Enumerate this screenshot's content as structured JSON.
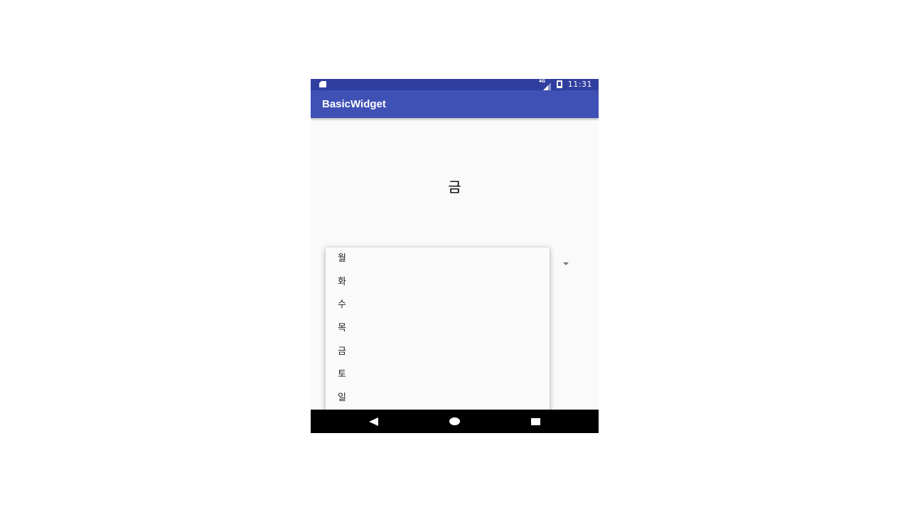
{
  "status_bar": {
    "network_label": "4G",
    "time": "11:31"
  },
  "app_bar": {
    "title": "BasicWidget"
  },
  "main": {
    "selected_day": "금"
  },
  "spinner": {
    "options": [
      "월",
      "화",
      "수",
      "목",
      "금",
      "토",
      "일"
    ]
  },
  "icons": {
    "status": [
      "sd-card-icon",
      "network-signal-icon",
      "battery-icon"
    ],
    "nav": [
      "back-icon",
      "home-icon",
      "recents-icon"
    ],
    "spinner": "dropdown-arrow-icon"
  },
  "colors": {
    "status_bar": "#303f9f",
    "app_bar": "#3f51b5",
    "background": "#fafafa",
    "nav_bar": "#000000"
  }
}
